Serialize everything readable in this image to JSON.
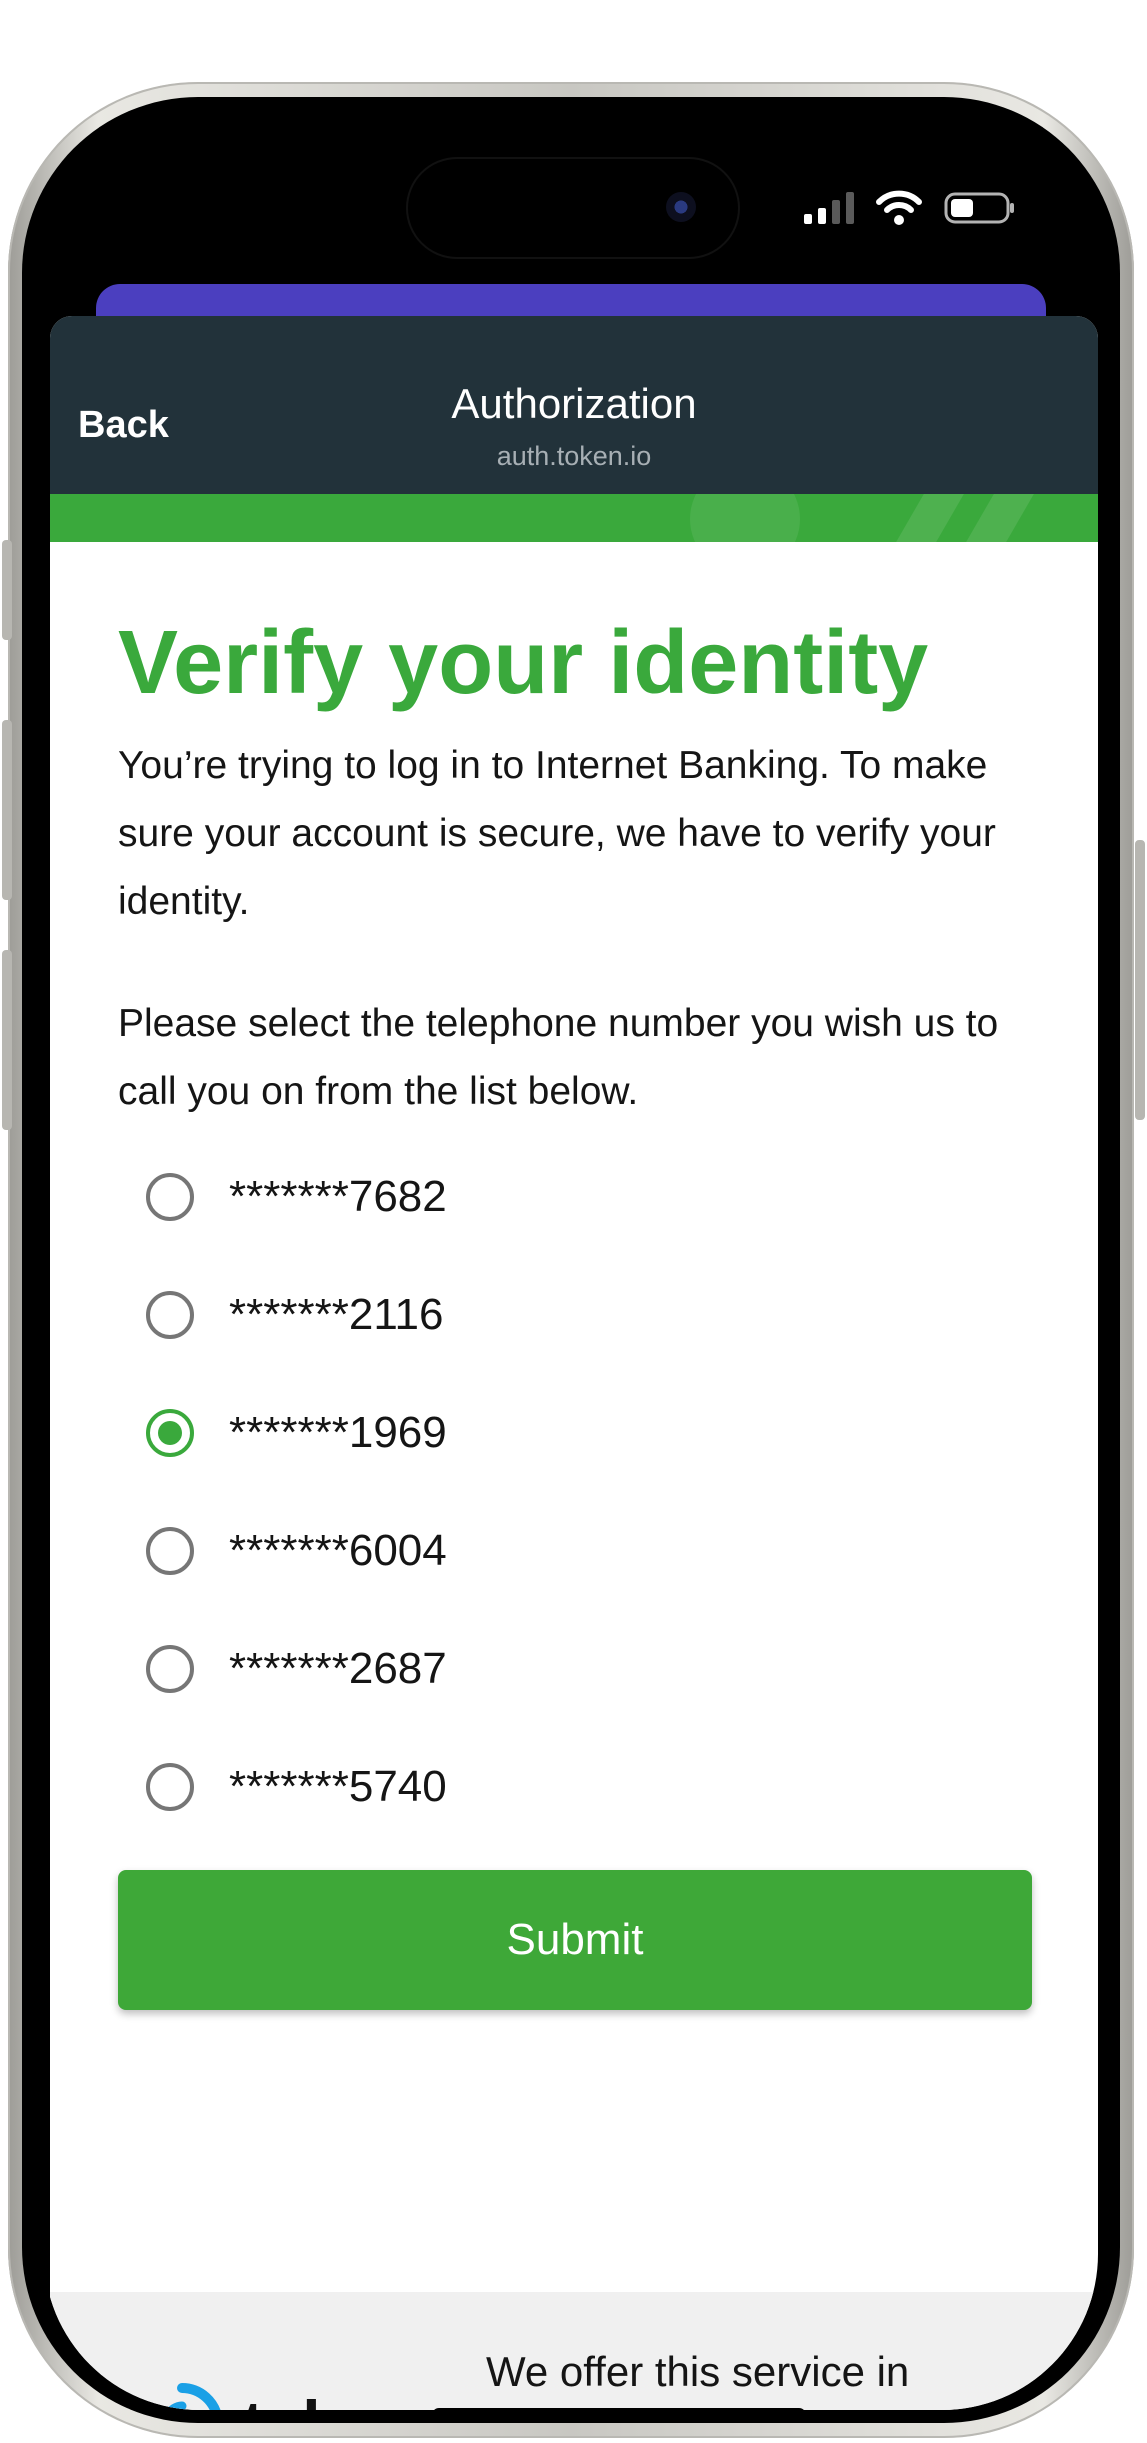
{
  "header": {
    "back_label": "Back",
    "title": "Authorization",
    "url": "auth.token.io"
  },
  "main": {
    "title": "Verify your identity",
    "intro": "You’re trying to log in to Internet Banking. To make sure your account is secure, we have to verify your identity.",
    "instruction": "Please select the telephone number you wish us to call you on from the list below.",
    "options": [
      {
        "label": "*******7682",
        "selected": false
      },
      {
        "label": "*******2116",
        "selected": false
      },
      {
        "label": "*******1969",
        "selected": true
      },
      {
        "label": "*******6004",
        "selected": false
      },
      {
        "label": "*******2687",
        "selected": false
      },
      {
        "label": "*******5740",
        "selected": false
      }
    ],
    "submit_label": "Submit"
  },
  "footer": {
    "logo_text": "token",
    "partnership_text": "We offer this service in partnership with Token.io"
  },
  "colors": {
    "accent_green": "#3aa93c",
    "header_dark": "#22323a",
    "token_blue": "#1aa0e6",
    "purple": "#4b3fbf"
  }
}
